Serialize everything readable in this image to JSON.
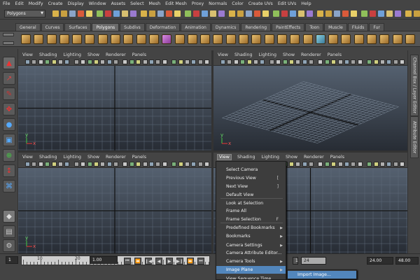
{
  "menubar": [
    "File",
    "Edit",
    "Modify",
    "Create",
    "Display",
    "Window",
    "Assets",
    "Select",
    "Mesh",
    "Edit Mesh",
    "Proxy",
    "Normals",
    "Color",
    "Create UVs",
    "Edit UVs",
    "Help"
  ],
  "mode_selector": "Polygons",
  "shelf_tabs": [
    "General",
    "Curves",
    "Surfaces",
    "Polygons",
    "Subdivs",
    "Deformation",
    "Animation",
    "Dynamics",
    "Rendering",
    "PaintEffects",
    "Toon",
    "Muscle",
    "Fluids",
    "Fur"
  ],
  "shelf_active": "Polygons",
  "panel_menu": [
    "View",
    "Shading",
    "Lighting",
    "Show",
    "Renderer",
    "Panels"
  ],
  "axis_labels": {
    "y": "y",
    "x": "x"
  },
  "side_tabs": {
    "channel_box": "Channel Box / Layer Editor",
    "attribute_editor": "Attribute Editor"
  },
  "context_menu": {
    "items": [
      {
        "label": "Select Camera",
        "shortcut": "",
        "submenu": false
      },
      {
        "label": "Previous View",
        "shortcut": "[",
        "submenu": false
      },
      {
        "label": "Next View",
        "shortcut": "]",
        "submenu": false
      },
      {
        "label": "Default View",
        "shortcut": "",
        "submenu": false
      },
      {
        "label": "Look at Selection",
        "shortcut": "",
        "submenu": false
      },
      {
        "label": "Frame All",
        "shortcut": "",
        "submenu": false
      },
      {
        "label": "Frame Selection",
        "shortcut": "F",
        "submenu": false
      },
      {
        "label": "Predefined Bookmarks",
        "shortcut": "",
        "submenu": true
      },
      {
        "label": "Bookmarks",
        "shortcut": "",
        "submenu": true
      },
      {
        "label": "Camera Settings",
        "shortcut": "",
        "submenu": true
      },
      {
        "label": "Camera Attribute Editor...",
        "shortcut": "",
        "submenu": false
      },
      {
        "label": "Camera Tools",
        "shortcut": "",
        "submenu": true
      },
      {
        "label": "Image Plane",
        "shortcut": "",
        "submenu": true
      },
      {
        "label": "View Sequence Time",
        "shortcut": "",
        "submenu": false
      }
    ],
    "highlighted": "Image Plane"
  },
  "submenu": {
    "items": [
      "Import Image..."
    ],
    "highlighted": "Import Image..."
  },
  "timeline": {
    "ruler_labels": [
      "10",
      "20"
    ],
    "start_field": "1",
    "current_time": "1.00",
    "range_start": "1",
    "range_end_inner": "24",
    "range_end": "24.00",
    "anim_end": "48.00"
  },
  "colors": {
    "menu_highlight": "#5286bc",
    "background": "#444444",
    "viewport_top": "#556170",
    "viewport_bottom": "#272c34"
  }
}
